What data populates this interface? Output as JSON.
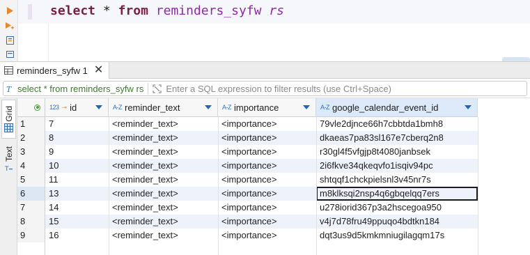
{
  "editor": {
    "keyword_select": "select",
    "star": "*",
    "keyword_from": "from",
    "table": "reminders_syfw",
    "alias": "rs"
  },
  "results_tab": {
    "label": "reminders_syfw 1"
  },
  "filter": {
    "query": "select * from reminders_syfw rs",
    "placeholder": "Enter a SQL expression to filter results (use Ctrl+Space)"
  },
  "side_tabs": {
    "grid": "Grid",
    "text": "Text"
  },
  "grid": {
    "columns": [
      {
        "type": "123",
        "name": "id"
      },
      {
        "type": "A-Z",
        "name": "reminder_text"
      },
      {
        "type": "A-Z",
        "name": "importance"
      },
      {
        "type": "A-Z",
        "name": "google_calendar_event_id"
      }
    ],
    "rows": [
      {
        "n": "1",
        "cells": [
          "7",
          "<reminder_text>",
          "<importance>",
          "79vle2djnce66h7cbbtda1bmh8"
        ]
      },
      {
        "n": "2",
        "cells": [
          "8",
          "<reminder_text>",
          "<importance>",
          "dkaeas7pa83sl167e7cberq2n8"
        ]
      },
      {
        "n": "3",
        "cells": [
          "9",
          "<reminder_text>",
          "<importance>",
          "r30gl4f5vfgjp8t4080janbsek"
        ]
      },
      {
        "n": "4",
        "cells": [
          "10",
          "<reminder_text>",
          "<importance>",
          "2i6fkve34qkeqvfo1isqiv94pc"
        ]
      },
      {
        "n": "5",
        "cells": [
          "11",
          "<reminder_text>",
          "<importance>",
          "shtqqf1chckpielsnl3v45nr7s"
        ]
      },
      {
        "n": "6",
        "cells": [
          "13",
          "<reminder_text>",
          "<importance>",
          "m8klksqi2nsp4q6gbqelqq7ers"
        ]
      },
      {
        "n": "7",
        "cells": [
          "14",
          "<reminder_text>",
          "<importance>",
          "u278iorid367p3a2hscegoa950"
        ]
      },
      {
        "n": "8",
        "cells": [
          "15",
          "<reminder_text>",
          "<importance>",
          "v4j7d78fru49ppuqo4bdtkn184"
        ]
      },
      {
        "n": "9",
        "cells": [
          "16",
          "<reminder_text>",
          "<importance>",
          "dqt3us9d5kmkmniugilagqm17s"
        ]
      }
    ]
  },
  "colors": {
    "keyword": "#7a1f3d",
    "identifier": "#8c2aa6",
    "query_text": "#3b7d2c",
    "sort_arrow": "#1f66b5",
    "alt_row": "#eef3fb"
  },
  "icons": [
    "execute-icon",
    "execute-script-icon",
    "explain-plan-icon",
    "load-plan-icon",
    "table-icon",
    "close-icon",
    "sql-filter-icon",
    "expand-filter-icon",
    "grid-icon",
    "text-icon",
    "sort-arrow-icon",
    "row-selector-icon"
  ]
}
